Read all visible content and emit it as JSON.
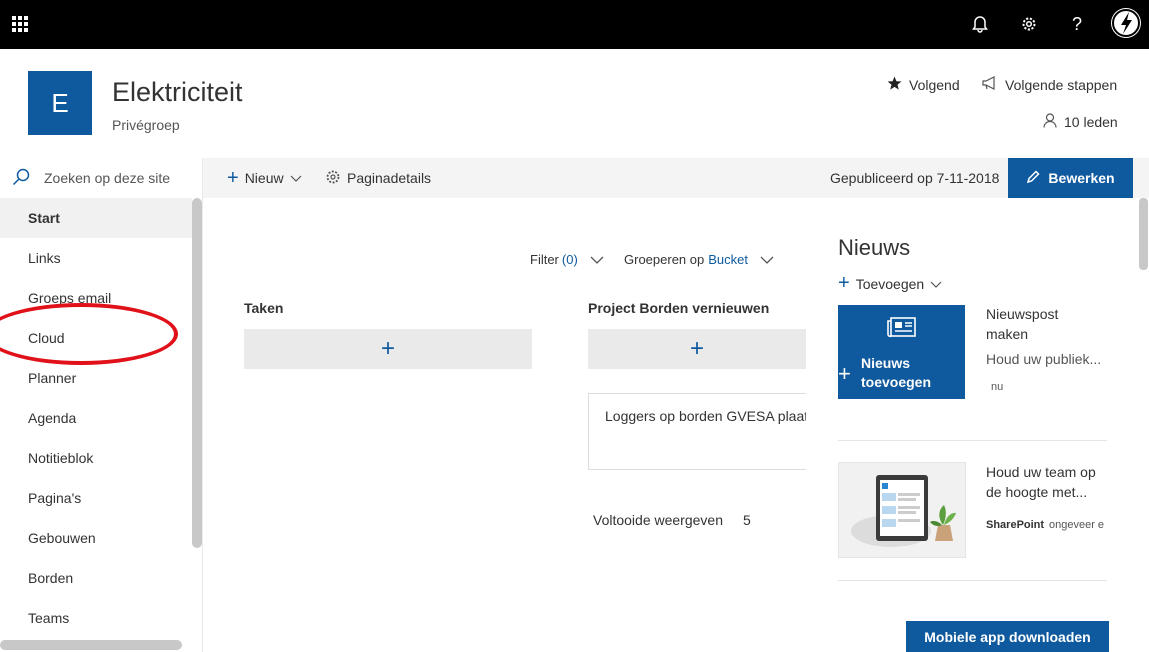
{
  "suite": {
    "icons": [
      "app-launcher-icon",
      "bell-icon",
      "gear-icon",
      "help-icon"
    ],
    "help_glyph": "?"
  },
  "site": {
    "logo_letter": "E",
    "title": "Elektriciteit",
    "subtitle": "Privégroep",
    "follow_label": "Volgend",
    "next_steps_label": "Volgende stappen",
    "members_label": "10 leden"
  },
  "search": {
    "placeholder": "Zoeken op deze site"
  },
  "commandbar": {
    "new_label": "Nieuw",
    "page_details_label": "Paginadetails",
    "published": "Gepubliceerd op 7-11-2018",
    "edit_label": "Bewerken"
  },
  "nav": {
    "items": [
      {
        "label": "Start",
        "active": true
      },
      {
        "label": "Links"
      },
      {
        "label": "Groeps email"
      },
      {
        "label": "Cloud"
      },
      {
        "label": "Planner"
      },
      {
        "label": "Agenda"
      },
      {
        "label": "Notitieblok"
      },
      {
        "label": "Pagina's"
      },
      {
        "label": "Gebouwen"
      },
      {
        "label": "Borden"
      },
      {
        "label": "Teams"
      }
    ]
  },
  "planner": {
    "filter_label": "Filter",
    "filter_count": "(0)",
    "group_label": "Groeperen op",
    "group_value": "Bucket",
    "buckets": [
      {
        "title": "Taken",
        "add_glyph": "+"
      },
      {
        "title": "Project Borden vernieuwen",
        "add_glyph": "+"
      }
    ],
    "task": "Loggers op borden GVESA plaatsen",
    "completed_label": "Voltooide weergeven",
    "completed_count": "5"
  },
  "news": {
    "title": "Nieuws",
    "add_label": "Toevoegen",
    "tile_label_1": "Nieuws",
    "tile_label_2": "toevoegen",
    "post_title_1": "Nieuwspost",
    "post_title_2": "maken",
    "post_sub": "Houd uw publiek...",
    "post_meta": "nu",
    "item2_title_1": "Houd uw team op",
    "item2_title_2": "de hoogte met...",
    "item2_source": "SharePoint",
    "item2_meta": "ongeveer e",
    "mobile_label": "Mobiele app downloaden"
  },
  "colors": {
    "brand": "#0f5a9e",
    "annotation": "#e1111a",
    "suitebar": "#000000"
  }
}
